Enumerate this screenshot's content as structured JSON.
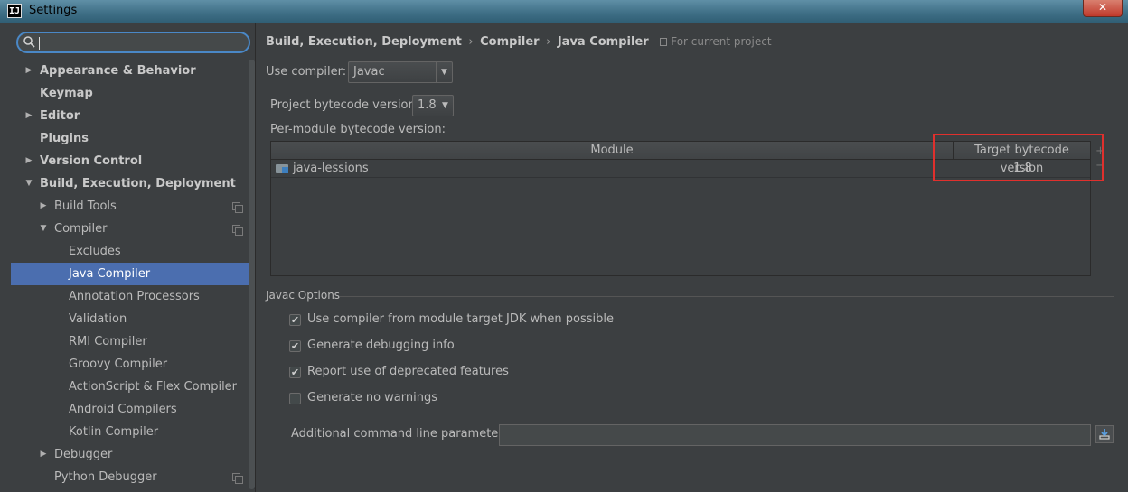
{
  "window": {
    "title": "Settings",
    "app_icon": "IJ",
    "close_glyph": "✕"
  },
  "sidebar": {
    "search": {
      "value": "",
      "placeholder": ""
    },
    "items": [
      {
        "label": "Appearance & Behavior",
        "level": 0,
        "arrow": "▶",
        "bold": true
      },
      {
        "label": "Keymap",
        "level": 0,
        "arrow": "",
        "bold": true
      },
      {
        "label": "Editor",
        "level": 0,
        "arrow": "▶",
        "bold": true
      },
      {
        "label": "Plugins",
        "level": 0,
        "arrow": "",
        "bold": true
      },
      {
        "label": "Version Control",
        "level": 0,
        "arrow": "▶",
        "bold": true
      },
      {
        "label": "Build, Execution, Deployment",
        "level": 0,
        "arrow": "▼",
        "bold": true
      },
      {
        "label": "Build Tools",
        "level": 1,
        "arrow": "▶",
        "bold": false,
        "copy": true
      },
      {
        "label": "Compiler",
        "level": 1,
        "arrow": "▼",
        "bold": false,
        "copy": true
      },
      {
        "label": "Excludes",
        "level": 2,
        "arrow": "",
        "bold": false
      },
      {
        "label": "Java Compiler",
        "level": 2,
        "arrow": "",
        "bold": false,
        "selected": true
      },
      {
        "label": "Annotation Processors",
        "level": 2,
        "arrow": "",
        "bold": false
      },
      {
        "label": "Validation",
        "level": 2,
        "arrow": "",
        "bold": false
      },
      {
        "label": "RMI Compiler",
        "level": 2,
        "arrow": "",
        "bold": false
      },
      {
        "label": "Groovy Compiler",
        "level": 2,
        "arrow": "",
        "bold": false
      },
      {
        "label": "ActionScript & Flex Compiler",
        "level": 2,
        "arrow": "",
        "bold": false
      },
      {
        "label": "Android Compilers",
        "level": 2,
        "arrow": "",
        "bold": false
      },
      {
        "label": "Kotlin Compiler",
        "level": 2,
        "arrow": "",
        "bold": false
      },
      {
        "label": "Debugger",
        "level": 1,
        "arrow": "▶",
        "bold": false
      },
      {
        "label": "Python Debugger",
        "level": 1,
        "arrow": "",
        "bold": false,
        "copy": true
      }
    ]
  },
  "main": {
    "breadcrumb": {
      "part1": "Build, Execution, Deployment",
      "part2": "Compiler",
      "part3": "Java Compiler",
      "sep": "›",
      "scope": "For current project"
    },
    "use_compiler": {
      "label": "Use compiler:",
      "value": "Javac"
    },
    "project_bytecode": {
      "label": "Project bytecode version:",
      "value": "1.8"
    },
    "per_module": {
      "label": "Per-module bytecode version:",
      "columns": [
        "Module",
        "Target bytecode version"
      ],
      "rows": [
        {
          "module": "java-lessions",
          "version": "1.8"
        }
      ],
      "add_glyph": "+",
      "remove_glyph": "−"
    },
    "javac_options": {
      "title": "Javac Options",
      "checkboxes": [
        {
          "label": "Use compiler from module target JDK when possible",
          "checked": true
        },
        {
          "label": "Generate debugging info",
          "checked": true
        },
        {
          "label": "Report use of deprecated features",
          "checked": true
        },
        {
          "label": "Generate no warnings",
          "checked": false
        }
      ],
      "params_label": "Additional command line parameters:",
      "params_value": ""
    }
  },
  "colors": {
    "selection": "#4b6eaf",
    "highlight_box": "#e0302d",
    "background": "#3c3f41"
  }
}
